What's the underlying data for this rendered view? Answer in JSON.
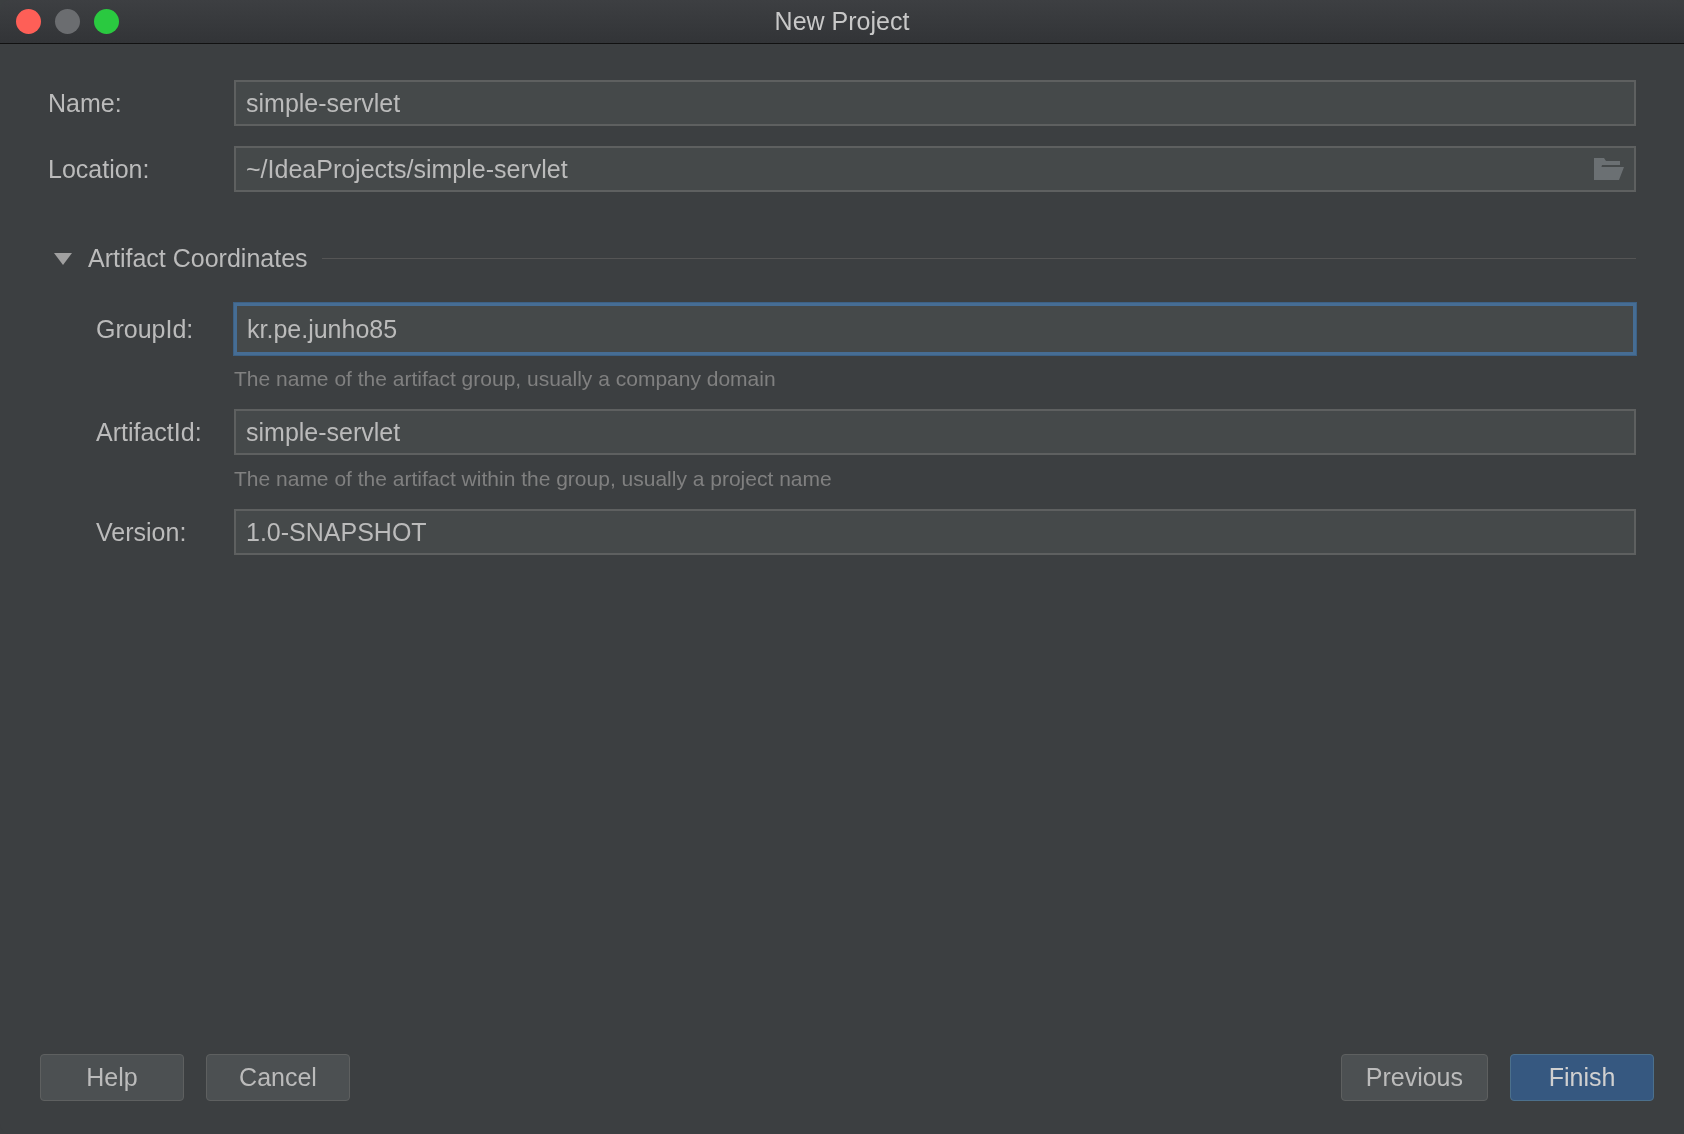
{
  "window": {
    "title": "New Project",
    "controls": [
      {
        "color": "#fe5f57"
      },
      {
        "color": "#6b6d70"
      },
      {
        "color": "#2ac940"
      }
    ]
  },
  "top_fields": [
    {
      "label": "Name:",
      "value": "simple-servlet",
      "focused": false,
      "browse": false
    },
    {
      "label": "Location:",
      "value": "~/IdeaProjects/simple-servlet",
      "focused": false,
      "browse": true
    }
  ],
  "section": {
    "title": "Artifact Coordinates",
    "expanded": true,
    "fields": [
      {
        "label": "GroupId:",
        "value": "kr.pe.junho85",
        "focused": true,
        "hint": "The name of the artifact group, usually a company domain"
      },
      {
        "label": "ArtifactId:",
        "value": "simple-servlet",
        "focused": false,
        "hint": "The name of the artifact within the group, usually a project name"
      },
      {
        "label": "Version:",
        "value": "1.0-SNAPSHOT",
        "focused": false
      }
    ]
  },
  "buttons_left": [
    {
      "label": "Help",
      "default": false
    },
    {
      "label": "Cancel",
      "default": false
    }
  ],
  "buttons_right": [
    {
      "label": "Previous",
      "default": false
    },
    {
      "label": "Finish",
      "default": true
    }
  ]
}
